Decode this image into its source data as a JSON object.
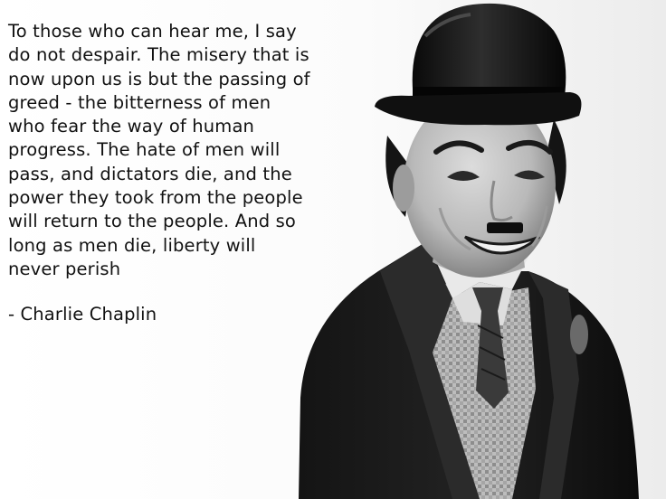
{
  "quote": {
    "lines": [
      "To those who can hear me, I say",
      "do not despair. The misery that is",
      "now upon us is but the passing of",
      "greed - the bitterness of men",
      "who fear the way of human",
      "progress. The hate of men will",
      "pass, and dictators die, and the",
      "power they took from the people",
      "will return to the people. And so",
      "long as men die, liberty will",
      "never perish"
    ],
    "attribution": "- Charlie Chaplin"
  }
}
